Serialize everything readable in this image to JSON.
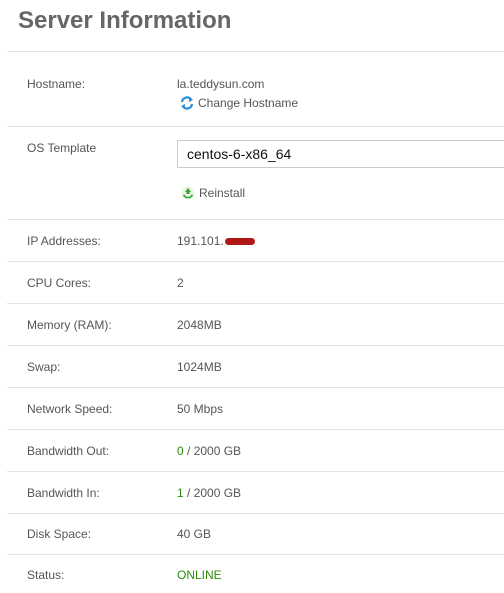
{
  "page": {
    "title": "Server Information"
  },
  "rows": {
    "hostname": {
      "label": "Hostname:",
      "value": "la.teddysun.com",
      "action": "Change Hostname"
    },
    "os_template": {
      "label": "OS Template",
      "selected": "centos-6-x86_64",
      "action": "Reinstall"
    },
    "ip": {
      "label": "IP Addresses:",
      "value": "191.101."
    },
    "cpu": {
      "label": "CPU Cores:",
      "value": "2"
    },
    "memory": {
      "label": "Memory (RAM):",
      "value": "2048MB"
    },
    "swap": {
      "label": "Swap:",
      "value": "1024MB"
    },
    "network": {
      "label": "Network Speed:",
      "value": "50 Mbps"
    },
    "bw_out": {
      "label": "Bandwidth Out:",
      "used": "0",
      "total": " / 2000 GB"
    },
    "bw_in": {
      "label": "Bandwidth In:",
      "used": "1",
      "total": " / 2000 GB"
    },
    "disk": {
      "label": "Disk Space:",
      "value": "40 GB"
    },
    "status": {
      "label": "Status:",
      "value": "ONLINE"
    }
  },
  "colors": {
    "online": "#2e8b0e",
    "redaction": "#b01818",
    "refresh_icon": "#2a8fd6",
    "reinstall_icon": "#3aa63a"
  },
  "icons": {
    "change_hostname": "refresh-icon",
    "reinstall": "recycle-icon"
  }
}
